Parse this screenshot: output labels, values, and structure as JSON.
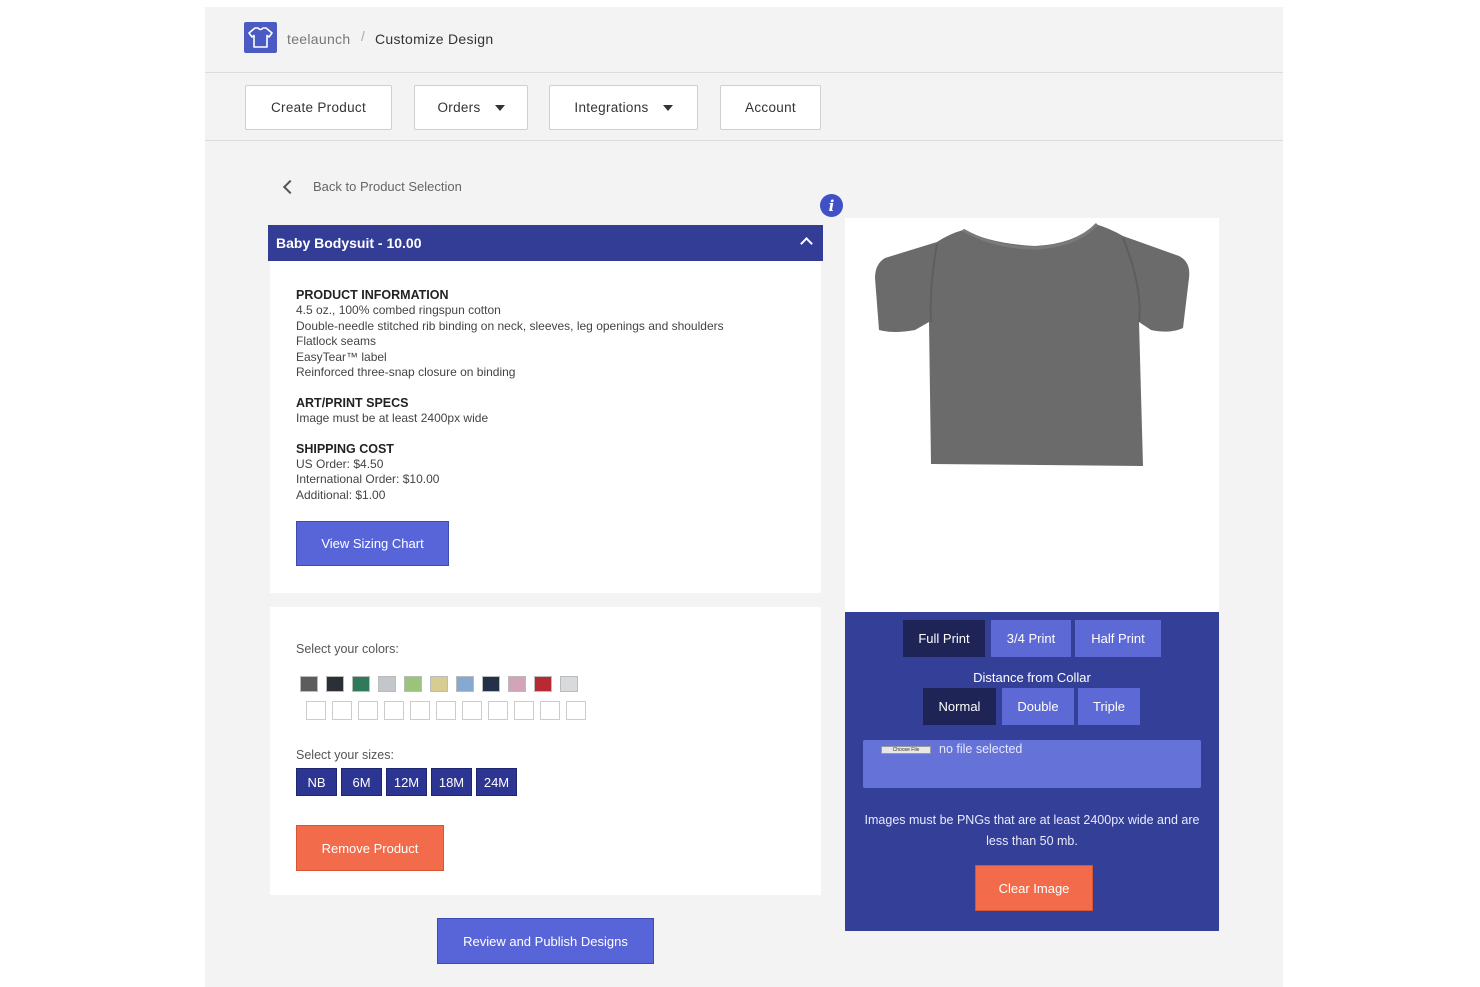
{
  "header": {
    "app_name": "teelaunch",
    "separator": "/",
    "page_title": "Customize Design"
  },
  "nav": {
    "create_product": "Create Product",
    "orders": "Orders",
    "integrations": "Integrations",
    "account": "Account"
  },
  "back_link": "Back to Product Selection",
  "info_icon": "i",
  "product": {
    "title": "Baby Bodysuit - 10.00",
    "info_title": "PRODUCT INFORMATION",
    "info_lines": [
      "4.5 oz., 100% combed ringspun cotton",
      "Double-needle stitched rib binding on neck, sleeves, leg openings and shoulders",
      "Flatlock seams",
      "EasyTear™ label",
      "Reinforced three-snap closure on binding"
    ],
    "specs_title": "ART/PRINT SPECS",
    "specs_lines": [
      "Image must be at least 2400px wide"
    ],
    "shipping_title": "SHIPPING COST",
    "shipping_lines": [
      "US Order: $4.50",
      "International Order: $10.00",
      "Additional: $1.00"
    ],
    "sizing_button": "View Sizing Chart"
  },
  "options": {
    "colors_label": "Select your colors:",
    "colors": [
      "#5c5c5c",
      "#2b2f36",
      "#2e7a5a",
      "#c3c6cb",
      "#9ac47a",
      "#d7cc92",
      "#85a9cf",
      "#243048",
      "#d3a3b8",
      "#b82a33",
      "#d9dadc"
    ],
    "sizes_label": "Select your sizes:",
    "sizes": [
      "NB",
      "6M",
      "12M",
      "18M",
      "24M"
    ],
    "remove_button": "Remove Product"
  },
  "publish_button": "Review and Publish Designs",
  "design": {
    "print_options": [
      "Full Print",
      "3/4 Print",
      "Half Print"
    ],
    "print_selected": "Full Print",
    "collar_label": "Distance from Collar",
    "collar_options": [
      "Normal",
      "Double",
      "Triple"
    ],
    "collar_selected": "Normal",
    "choose_file": "Choose File",
    "file_status": "no file selected",
    "note": "Images must be PNGs that are at least 2400px wide and are less than 50 mb.",
    "clear_button": "Clear Image"
  },
  "colors": {
    "accent": "#333d96",
    "button": "#5865d8",
    "danger": "#f26b4b",
    "garment": "#6b6b6b"
  }
}
